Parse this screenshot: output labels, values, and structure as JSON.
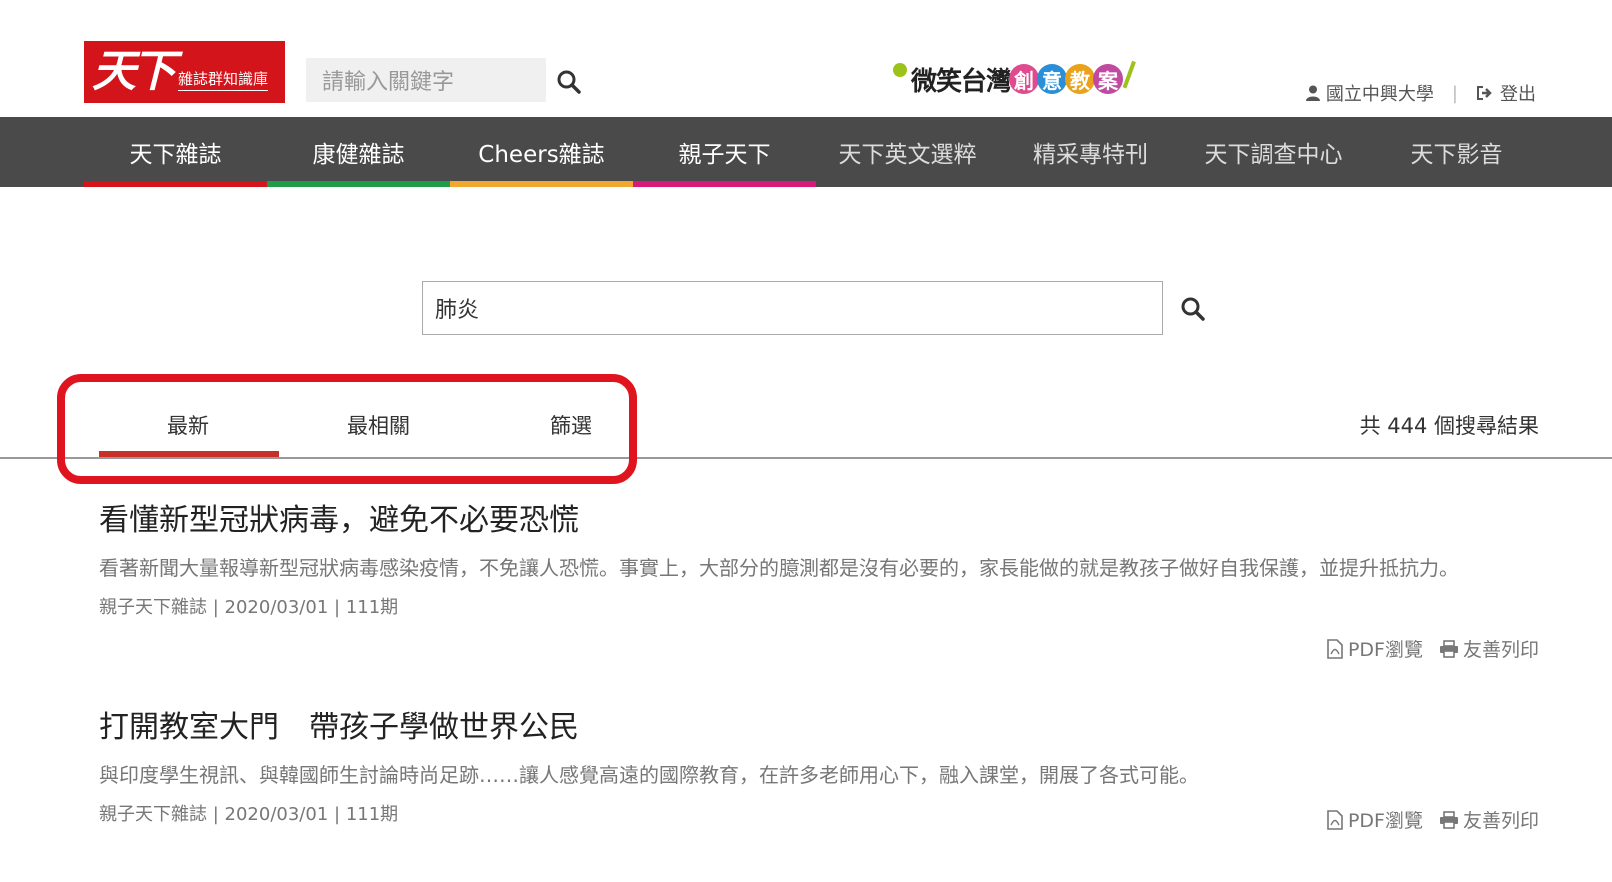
{
  "header": {
    "logo_main": "天下",
    "logo_sub": "雜誌群知識庫",
    "search_placeholder": "請輸入關鍵字",
    "campaign_prefix": "微笑台灣",
    "campaign_chars": [
      "創",
      "意",
      "教",
      "案"
    ],
    "campaign_colors": [
      "#e04a8f",
      "#2a8fd6",
      "#e9a21a",
      "#c04aa0"
    ],
    "user_name": "國立中興大學",
    "logout_label": "登出"
  },
  "nav": {
    "items": [
      {
        "label": "天下雜誌",
        "color": "#d3141b"
      },
      {
        "label": "康健雜誌",
        "color": "#1f9b4a"
      },
      {
        "label": "Cheers雜誌",
        "color": "#f0a830"
      },
      {
        "label": "親子天下",
        "color": "#d8187a"
      },
      {
        "label": "天下英文選粹",
        "color": ""
      },
      {
        "label": "精采專特刊",
        "color": ""
      },
      {
        "label": "天下調查中心",
        "color": ""
      },
      {
        "label": "天下影音",
        "color": ""
      }
    ]
  },
  "search": {
    "query": "肺炎"
  },
  "tabs": {
    "items": [
      "最新",
      "最相關",
      "篩選"
    ],
    "active": "最新",
    "result_count": "共 444 個搜尋結果"
  },
  "results": [
    {
      "title": "看懂新型冠狀病毒，避免不必要恐慌",
      "summary": "看著新聞大量報導新型冠狀病毒感染疫情，不免讓人恐慌。事實上，大部分的臆測都是沒有必要的，家長能做的就是教孩子做好自我保護，並提升抵抗力。",
      "source": "親子天下雜誌",
      "date": "2020/03/01",
      "issue": "111期",
      "pdf_label": "PDF瀏覽",
      "print_label": "友善列印"
    },
    {
      "title": "打開教室大門　帶孩子學做世界公民",
      "summary": "與印度學生視訊、與韓國師生討論時尚足跡……讓人感覺高遠的國際教育，在許多老師用心下，融入課堂，開展了各式可能。",
      "source": "親子天下雜誌",
      "date": "2020/03/01",
      "issue": "111期",
      "pdf_label": "PDF瀏覽",
      "print_label": "友善列印"
    }
  ]
}
